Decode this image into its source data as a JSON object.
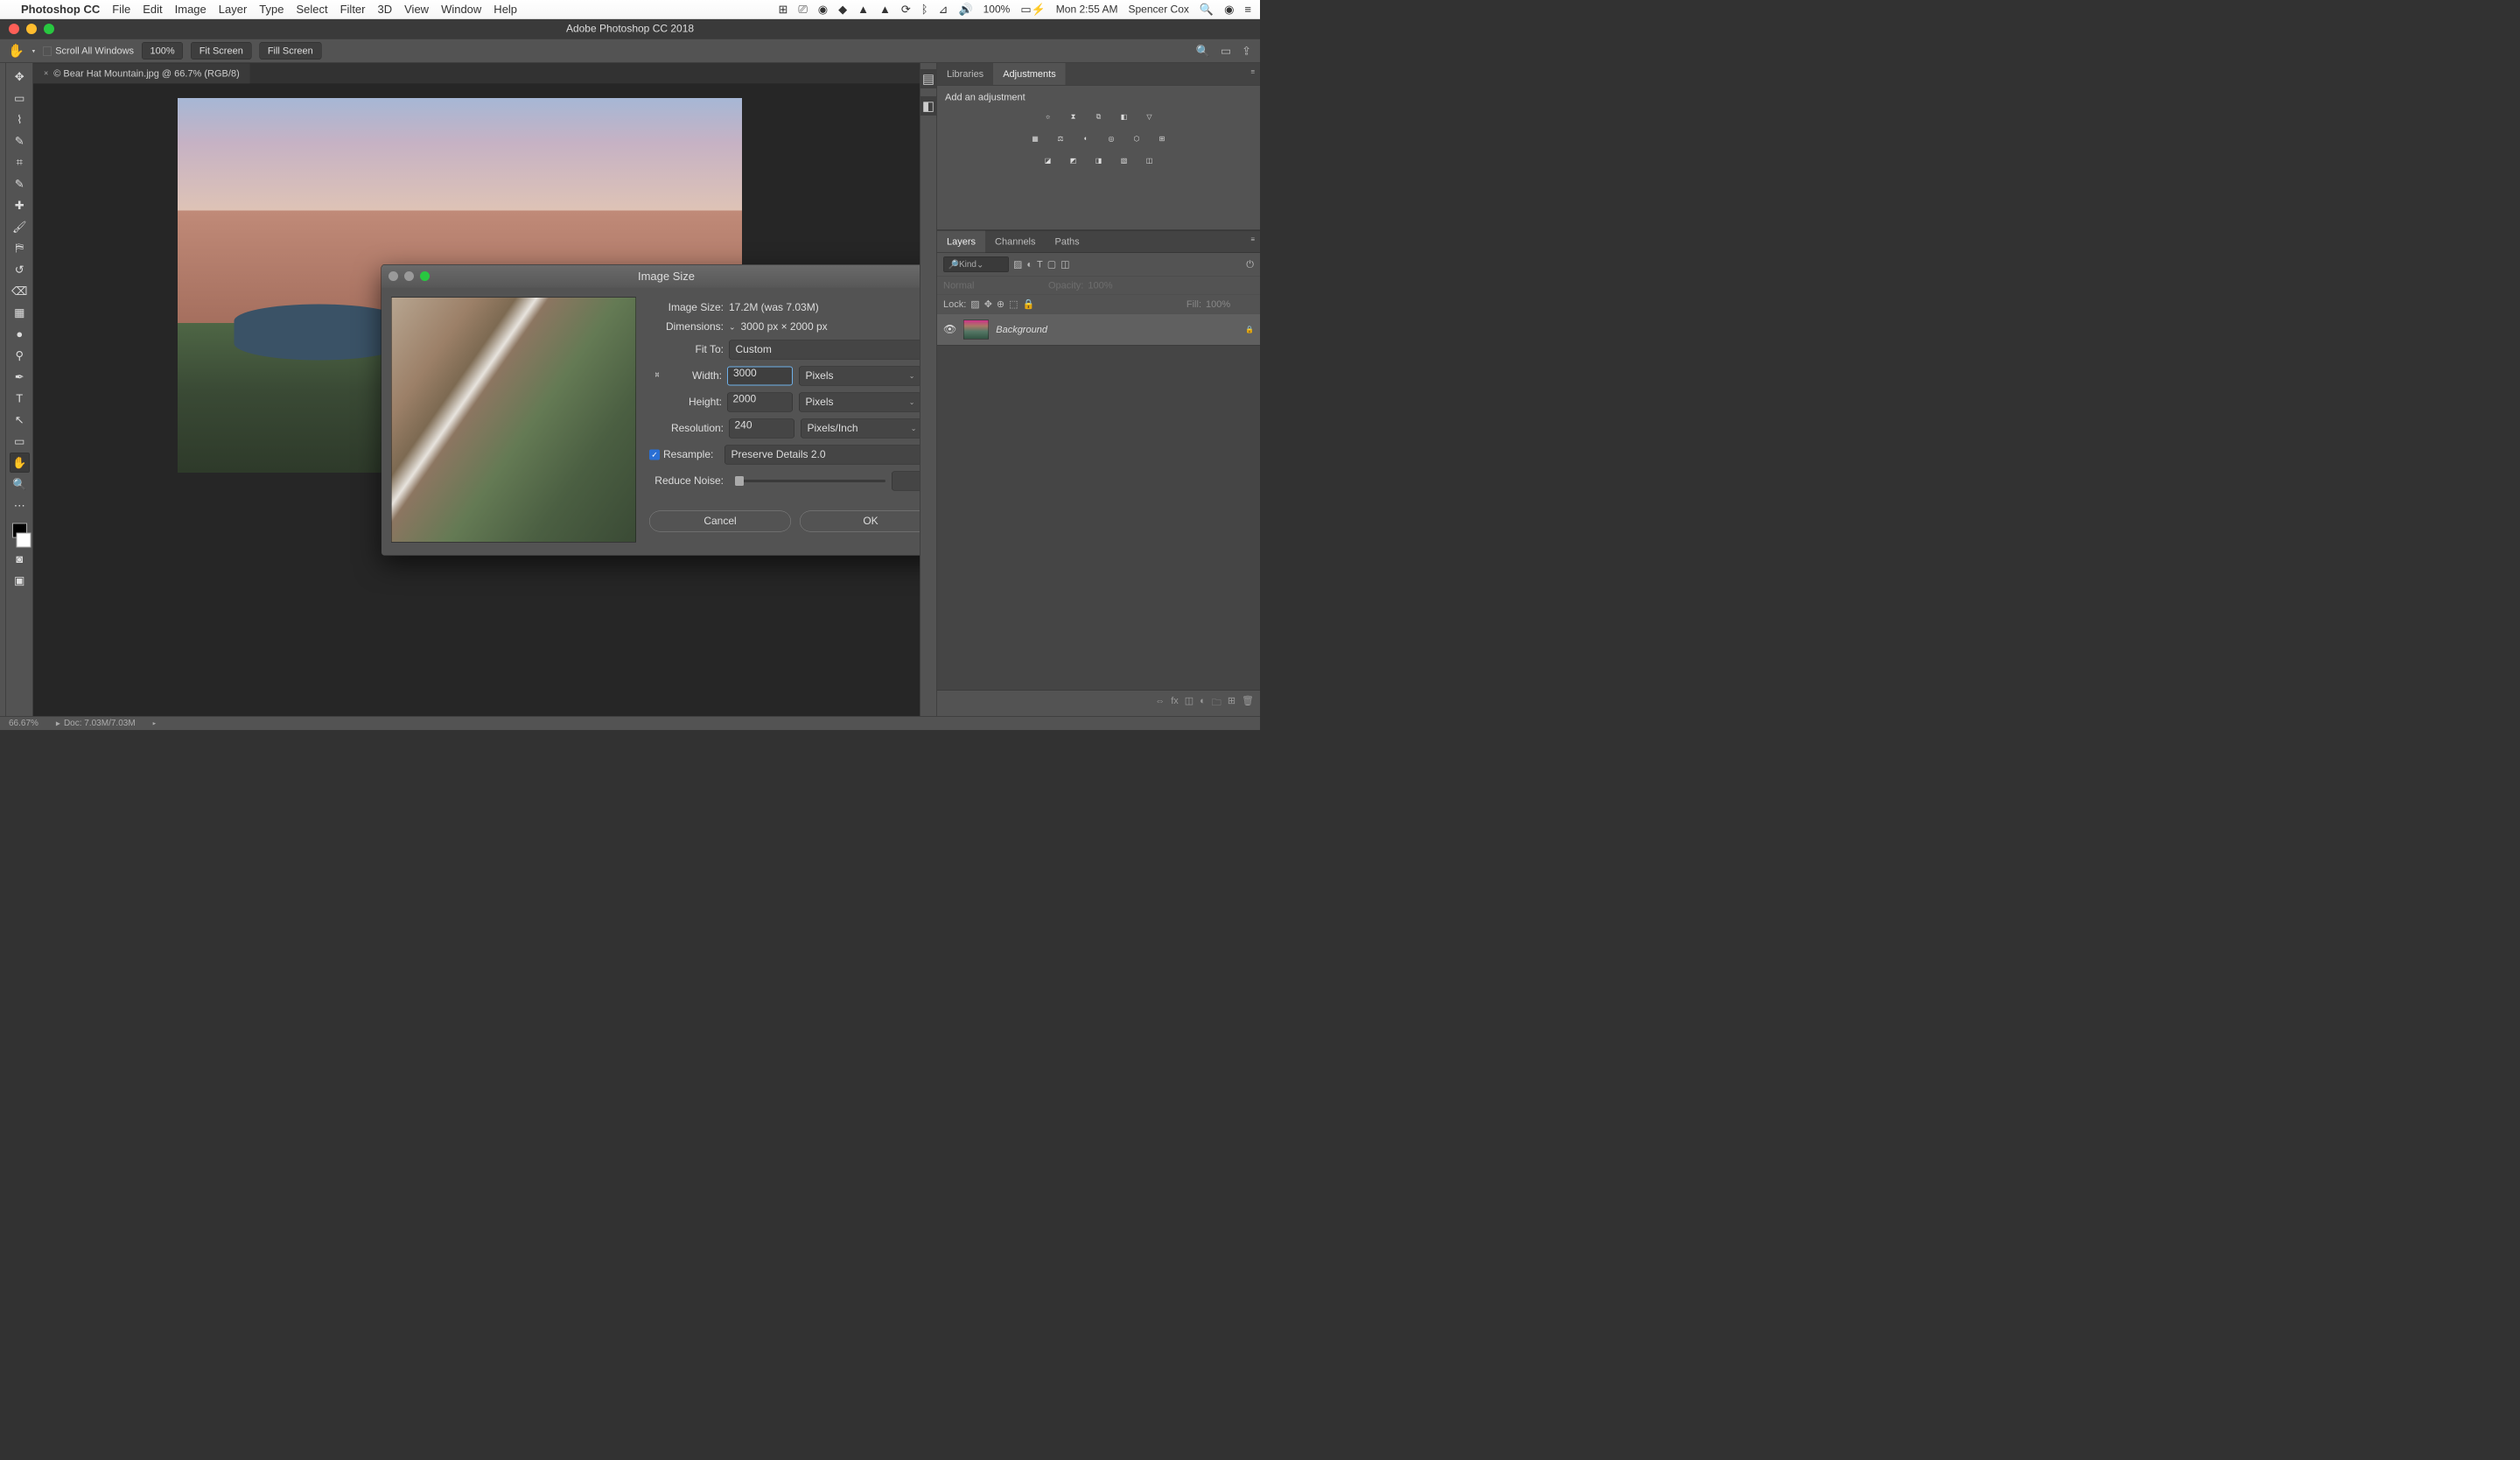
{
  "menubar": {
    "app": "Photoshop CC",
    "items": [
      "File",
      "Edit",
      "Image",
      "Layer",
      "Type",
      "Select",
      "Filter",
      "3D",
      "View",
      "Window",
      "Help"
    ],
    "battery": "100%",
    "clock": "Mon 2:55 AM",
    "user": "Spencer Cox"
  },
  "window": {
    "title": "Adobe Photoshop CC 2018"
  },
  "options": {
    "scroll_label": "Scroll All Windows",
    "zoom": "100%",
    "fit": "Fit Screen",
    "fill": "Fill Screen"
  },
  "document": {
    "tab": "© Bear Hat Mountain.jpg @ 66.7% (RGB/8)"
  },
  "dialog": {
    "title": "Image Size",
    "image_size_label": "Image Size:",
    "image_size_value": "17.2M (was 7.03M)",
    "dimensions_label": "Dimensions:",
    "dimensions_value": "3000 px  ×  2000 px",
    "fit_to_label": "Fit To:",
    "fit_to_value": "Custom",
    "width_label": "Width:",
    "width_value": "3000",
    "width_unit": "Pixels",
    "height_label": "Height:",
    "height_value": "2000",
    "height_unit": "Pixels",
    "resolution_label": "Resolution:",
    "resolution_value": "240",
    "resolution_unit": "Pixels/Inch",
    "resample_label": "Resample:",
    "resample_value": "Preserve Details 2.0",
    "noise_label": "Reduce Noise:",
    "noise_value": "0",
    "noise_unit": "%",
    "cancel": "Cancel",
    "ok": "OK"
  },
  "adjustments": {
    "tab1": "Libraries",
    "tab2": "Adjustments",
    "header": "Add an adjustment"
  },
  "layers": {
    "tab1": "Layers",
    "tab2": "Channels",
    "tab3": "Paths",
    "kind": "Kind",
    "blend": "Normal",
    "opacity_label": "Opacity:",
    "opacity": "100%",
    "lock_label": "Lock:",
    "fill_label": "Fill:",
    "fill": "100%",
    "layer_name": "Background"
  },
  "status": {
    "zoom": "66.67%",
    "doc": "Doc: 7.03M/7.03M"
  }
}
